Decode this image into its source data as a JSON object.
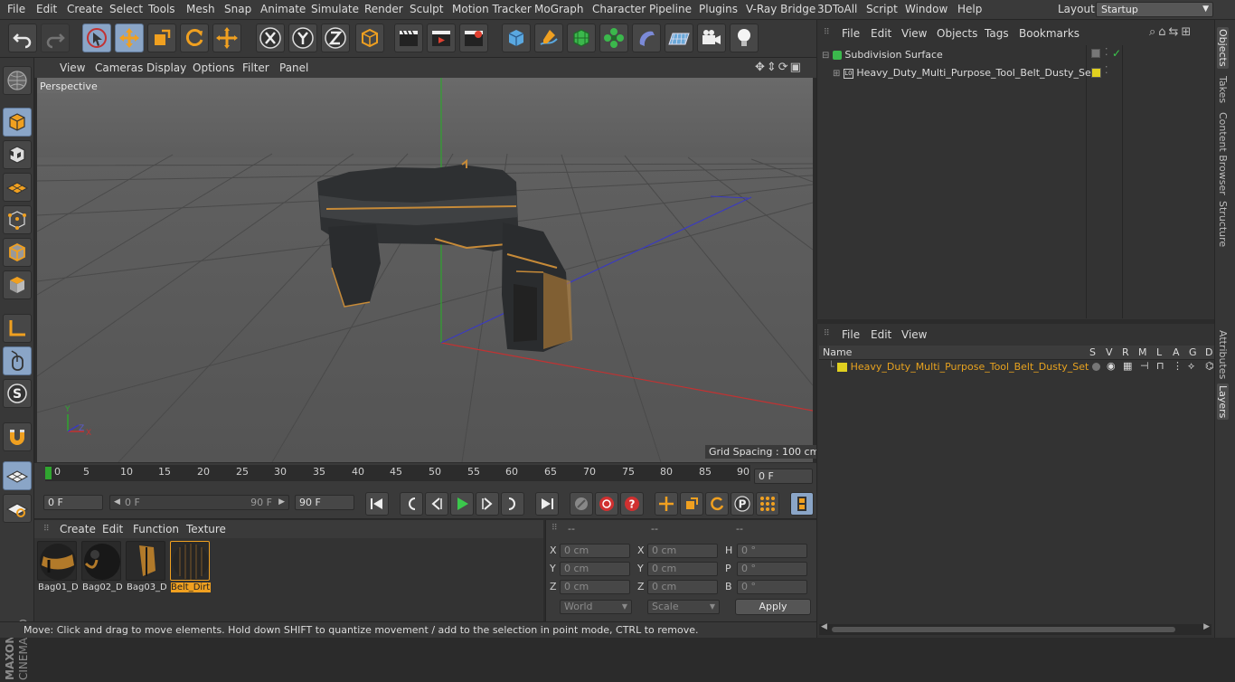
{
  "menubar": {
    "items": [
      "File",
      "Edit",
      "Create",
      "Select",
      "Tools",
      "Mesh",
      "Snap",
      "Animate",
      "Simulate",
      "Render",
      "Sculpt",
      "Motion Tracker",
      "MoGraph",
      "Character",
      "Pipeline",
      "Plugins",
      "V-Ray Bridge",
      "3DToAll",
      "Script",
      "Window",
      "Help"
    ],
    "layout_label": "Layout:",
    "layout_value": "Startup"
  },
  "viewport": {
    "menu": [
      "View",
      "Cameras",
      "Display",
      "Options",
      "Filter",
      "Panel"
    ],
    "camera_label": "Perspective",
    "grid_spacing": "Grid Spacing : 100 cm"
  },
  "timeline": {
    "ticks": [
      "0",
      "5",
      "10",
      "15",
      "20",
      "25",
      "30",
      "35",
      "40",
      "45",
      "50",
      "55",
      "60",
      "65",
      "70",
      "75",
      "80",
      "85",
      "90"
    ],
    "current_frame": "0 F",
    "start_field": "0 F",
    "range_start": "0 F",
    "range_end": "90 F",
    "end_field": "90 F"
  },
  "materials": {
    "menu": [
      "Create",
      "Edit",
      "Function",
      "Texture"
    ],
    "items": [
      "Bag01_D",
      "Bag02_D",
      "Bag03_D",
      "Belt_Dirt"
    ]
  },
  "coords": {
    "headers": [
      "--",
      "--",
      "--"
    ],
    "rows": [
      {
        "l1": "X",
        "v1": "0 cm",
        "l2": "X",
        "v2": "0 cm",
        "l3": "H",
        "v3": "0 °"
      },
      {
        "l1": "Y",
        "v1": "0 cm",
        "l2": "Y",
        "v2": "0 cm",
        "l3": "P",
        "v3": "0 °"
      },
      {
        "l1": "Z",
        "v1": "0 cm",
        "l2": "Z",
        "v2": "0 cm",
        "l3": "B",
        "v3": "0 °"
      }
    ],
    "world_dropdown": "World",
    "scale_dropdown": "Scale",
    "apply_label": "Apply"
  },
  "status": {
    "text": "Move: Click and drag to move elements. Hold down SHIFT to quantize movement / add to the selection in point mode, CTRL to remove."
  },
  "object_manager": {
    "menu": [
      "File",
      "Edit",
      "View",
      "Objects",
      "Tags",
      "Bookmarks"
    ],
    "objects": [
      "Subdivision Surface",
      "Heavy_Duty_Multi_Purpose_Tool_Belt_Dusty_Set"
    ]
  },
  "layer_manager": {
    "menu": [
      "File",
      "Edit",
      "View"
    ],
    "columns": [
      "Name",
      "S",
      "V",
      "R",
      "M",
      "L",
      "A",
      "G",
      "D"
    ],
    "layer_name": "Heavy_Duty_Multi_Purpose_Tool_Belt_Dusty_Set",
    "layer_color": "#e0d020"
  },
  "right_tabs": [
    "Objects",
    "Takes",
    "Content Browser",
    "Structure",
    "Attributes",
    "Layers"
  ],
  "colors": {
    "accent_blue": "#8aa5c7",
    "layer_orange": "#e7a21f",
    "axis_x": "#c23232",
    "axis_y": "#2fa52f",
    "axis_z": "#3a3ac2"
  }
}
